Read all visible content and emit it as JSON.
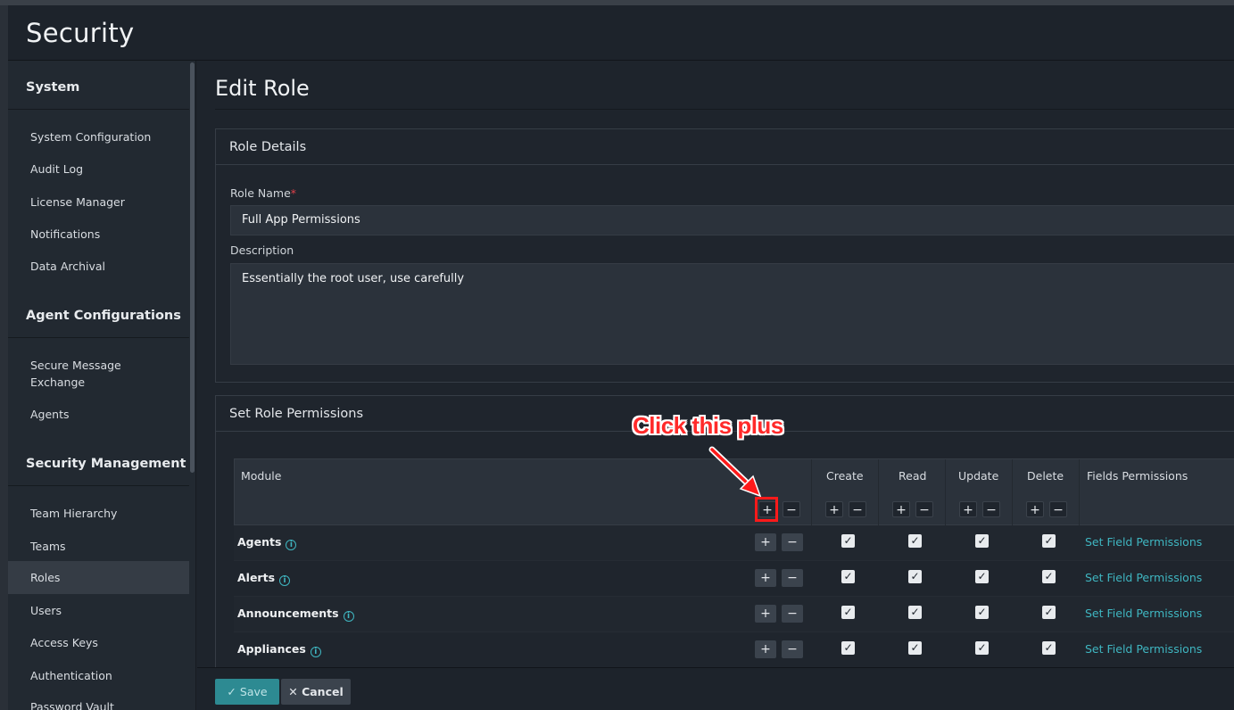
{
  "app": {
    "title": "Security"
  },
  "sidebar": {
    "sections": [
      {
        "title": "System",
        "items": [
          "System Configuration",
          "Audit Log",
          "License Manager",
          "Notifications",
          "Data Archival"
        ]
      },
      {
        "title": "Agent Configurations",
        "items": [
          "Secure Message Exchange",
          "Agents"
        ]
      },
      {
        "title": "Security Management",
        "items": [
          "Team Hierarchy",
          "Teams",
          "Roles",
          "Users",
          "Access Keys",
          "Authentication",
          "Password Vault"
        ]
      }
    ],
    "active_item": "Roles"
  },
  "page": {
    "title": "Edit Role"
  },
  "role_details": {
    "heading": "Role Details",
    "name_label": "Role Name",
    "required_mark": "*",
    "name_value": "Full App Permissions",
    "description_label": "Description",
    "description_value": "Essentially the root user, use carefully"
  },
  "permissions": {
    "heading": "Set Role Permissions",
    "columns": [
      "Module",
      "Create",
      "Read",
      "Update",
      "Delete",
      "Fields Permissions"
    ],
    "plus_glyph": "+",
    "minus_glyph": "−",
    "check_glyph": "✓",
    "info_glyph": "i",
    "rows": [
      {
        "module": "Agents",
        "create": true,
        "read": true,
        "update": true,
        "delete": true,
        "link": "Set Field Permissions"
      },
      {
        "module": "Alerts",
        "create": true,
        "read": true,
        "update": true,
        "delete": true,
        "link": "Set Field Permissions"
      },
      {
        "module": "Announcements",
        "create": true,
        "read": true,
        "update": true,
        "delete": true,
        "link": "Set Field Permissions"
      },
      {
        "module": "Appliances",
        "create": true,
        "read": true,
        "update": true,
        "delete": true,
        "link": "Set Field Permissions"
      }
    ]
  },
  "footer": {
    "save_label": "Save",
    "cancel_label": "Cancel",
    "save_icon": "✓",
    "cancel_icon": "✕"
  },
  "annotation": {
    "text": "Click this plus",
    "color": "#ff2a2a"
  },
  "colors": {
    "accent": "#3fb6c1",
    "save": "#2d8a92",
    "annotation": "#ff1a1a"
  }
}
